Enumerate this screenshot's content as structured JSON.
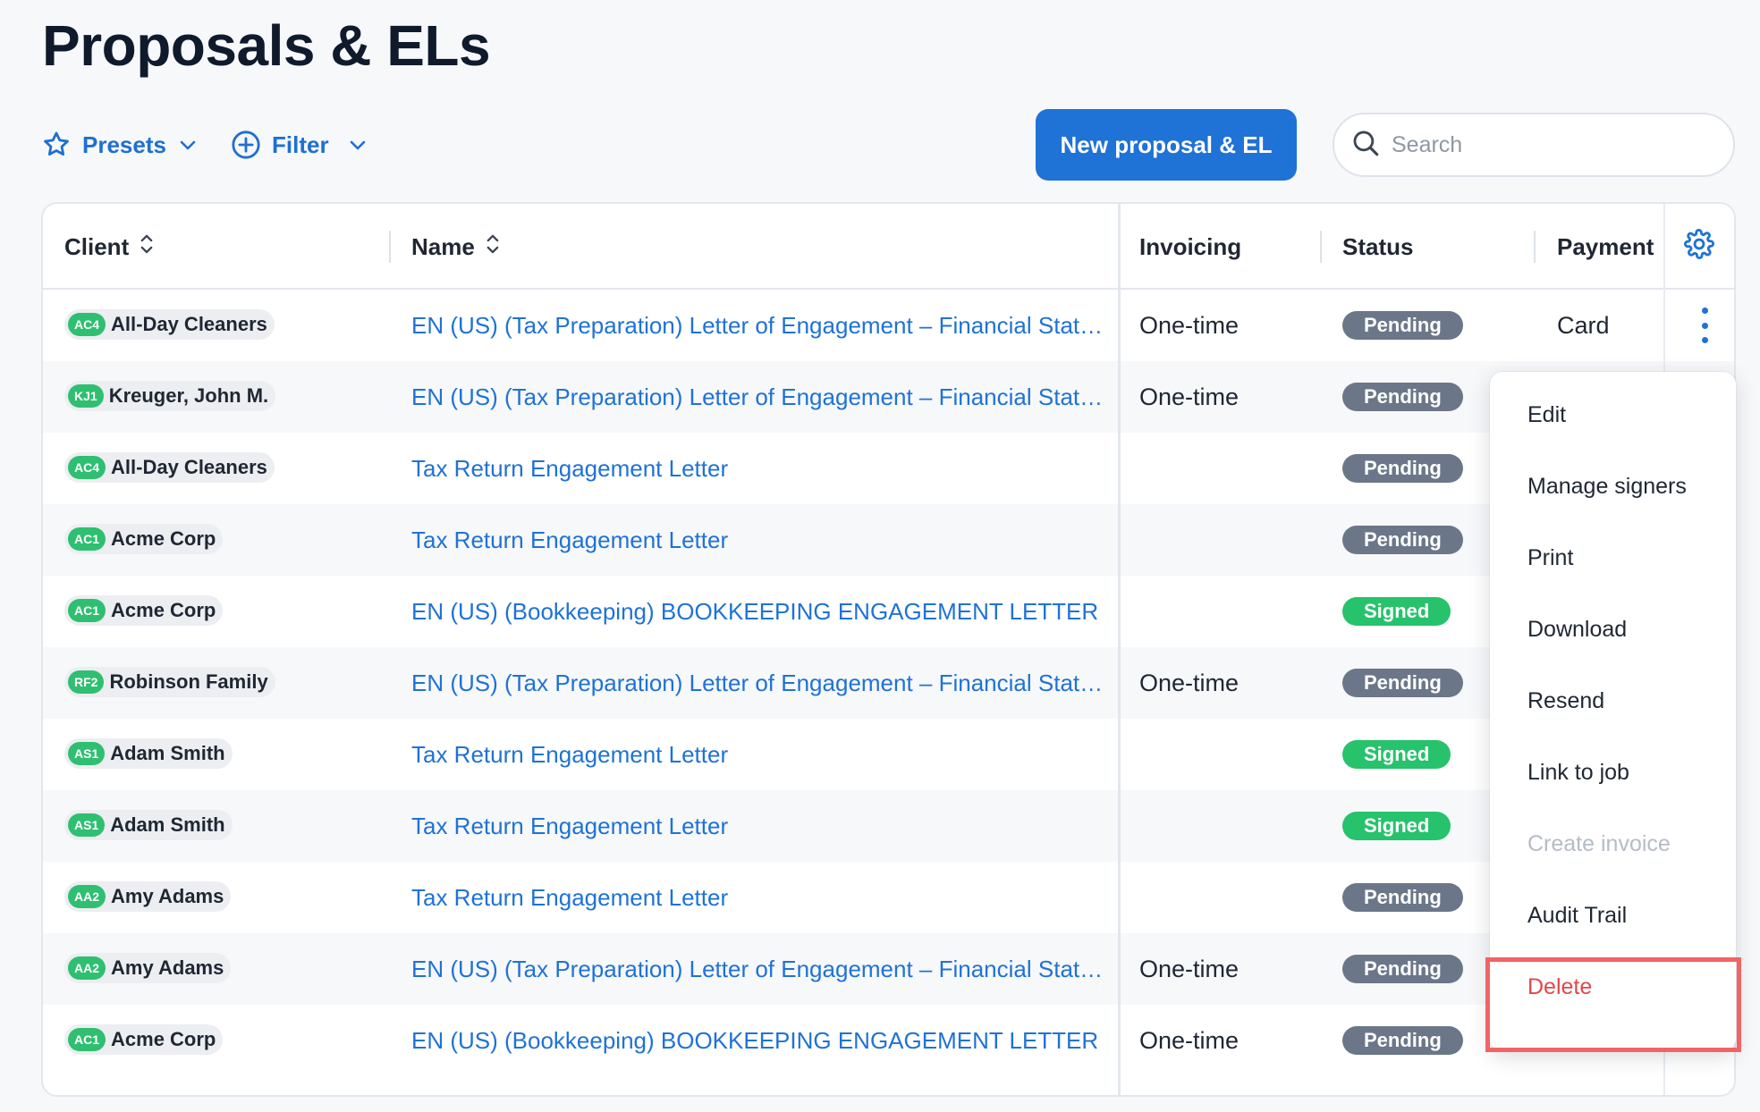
{
  "page": {
    "title": "Proposals & ELs"
  },
  "toolbar": {
    "presets_label": "Presets",
    "filter_label": "Filter",
    "new_button_label": "New proposal & EL",
    "search_placeholder": "Search"
  },
  "table": {
    "columns": {
      "client": "Client",
      "name": "Name",
      "invoicing": "Invoicing",
      "status": "Status",
      "payment": "Payment"
    },
    "rows": [
      {
        "client_code": "AC4",
        "client": "All-Day Cleaners",
        "name": "EN (US) (Tax Preparation) Letter of Engagement – Financial Stat…",
        "invoicing": "One-time",
        "status": "Pending",
        "payment": "Card"
      },
      {
        "client_code": "KJ1",
        "client": "Kreuger, John M.",
        "name": "EN (US) (Tax Preparation) Letter of Engagement – Financial Stat…",
        "invoicing": "One-time",
        "status": "Pending",
        "payment": ""
      },
      {
        "client_code": "AC4",
        "client": "All-Day Cleaners",
        "name": "Tax Return Engagement Letter",
        "invoicing": "",
        "status": "Pending",
        "payment": ""
      },
      {
        "client_code": "AC1",
        "client": "Acme Corp",
        "name": "Tax Return Engagement Letter",
        "invoicing": "",
        "status": "Pending",
        "payment": ""
      },
      {
        "client_code": "AC1",
        "client": "Acme Corp",
        "name": "EN (US) (Bookkeeping) BOOKKEEPING ENGAGEMENT LETTER",
        "invoicing": "",
        "status": "Signed",
        "payment": ""
      },
      {
        "client_code": "RF2",
        "client": "Robinson Family",
        "name": "EN (US) (Tax Preparation) Letter of Engagement – Financial Stat…",
        "invoicing": "One-time",
        "status": "Pending",
        "payment": ""
      },
      {
        "client_code": "AS1",
        "client": "Adam Smith",
        "name": "Tax Return Engagement Letter",
        "invoicing": "",
        "status": "Signed",
        "payment": ""
      },
      {
        "client_code": "AS1",
        "client": "Adam Smith",
        "name": "Tax Return Engagement Letter",
        "invoicing": "",
        "status": "Signed",
        "payment": ""
      },
      {
        "client_code": "AA2",
        "client": "Amy Adams",
        "name": "Tax Return Engagement Letter",
        "invoicing": "",
        "status": "Pending",
        "payment": ""
      },
      {
        "client_code": "AA2",
        "client": "Amy Adams",
        "name": "EN (US) (Tax Preparation) Letter of Engagement – Financial Stat…",
        "invoicing": "One-time",
        "status": "Pending",
        "payment": ""
      },
      {
        "client_code": "AC1",
        "client": "Acme Corp",
        "name": "EN (US) (Bookkeeping) BOOKKEEPING ENGAGEMENT LETTER",
        "invoicing": "One-time",
        "status": "Pending",
        "payment": ""
      }
    ]
  },
  "context_menu": {
    "items": [
      {
        "label": "Edit",
        "enabled": true
      },
      {
        "label": "Manage signers",
        "enabled": true
      },
      {
        "label": "Print",
        "enabled": true
      },
      {
        "label": "Download",
        "enabled": true
      },
      {
        "label": "Resend",
        "enabled": true
      },
      {
        "label": "Link to job",
        "enabled": true
      },
      {
        "label": "Create invoice",
        "enabled": false
      },
      {
        "label": "Audit Trail",
        "enabled": true
      },
      {
        "label": "Delete",
        "enabled": true,
        "danger": true
      }
    ]
  },
  "colors": {
    "accent": "#1f72d6",
    "pending": "#6b7789",
    "signed": "#27c26c",
    "client_code": "#2fbf71",
    "danger": "#e04848",
    "highlight": "#f26464"
  },
  "icons": {
    "presets": "star-icon",
    "filter": "plus-circle-icon",
    "dropdown": "chevron-down-icon",
    "sort": "sort-icon",
    "settings": "gear-icon",
    "row_menu": "kebab-icon",
    "search": "search-icon"
  }
}
